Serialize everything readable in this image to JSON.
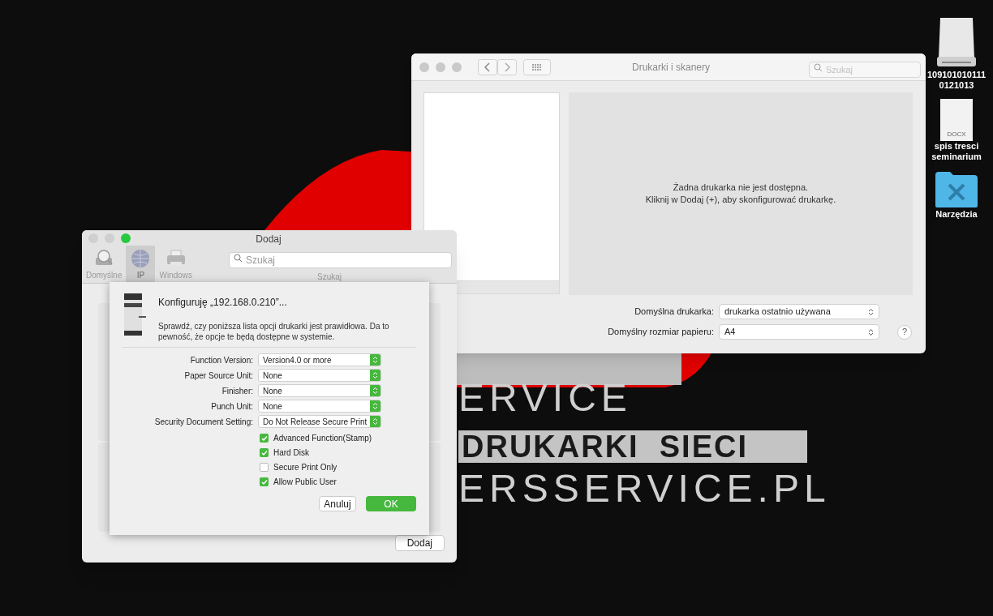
{
  "desktop": {
    "wallpaper_texts": [
      {
        "kind": "light",
        "text": "ERVICE"
      },
      {
        "kind": "band",
        "text": "DRUKARKI  SIECI"
      },
      {
        "kind": "light",
        "text": "ERSSERVICE.PL"
      }
    ],
    "icons": [
      {
        "kind": "drive",
        "lines": [
          "109101010111",
          "0121013"
        ]
      },
      {
        "kind": "document",
        "badge": "DOCX",
        "lines": [
          "spis tresci",
          "seminarium"
        ]
      },
      {
        "kind": "folder",
        "lines": [
          "Narzędzia"
        ]
      }
    ]
  },
  "printers_window": {
    "title": "Drukarki i skanery",
    "traffic_lights": [
      {
        "color": "#c9c9c9"
      },
      {
        "color": "#c9c9c9"
      },
      {
        "color": "#c9c9c9"
      }
    ],
    "search": {
      "placeholder": "Szukaj"
    },
    "empty_message": [
      "Żadna drukarka nie jest dostępna.",
      "Kliknij w Dodaj (+), aby skonfigurować drukarkę."
    ],
    "defaults": [
      {
        "label": "Domyślna drukarka:",
        "value": "drukarka ostatnio używana"
      },
      {
        "label": "Domyślny rozmiar papieru:",
        "value": "A4"
      }
    ],
    "help": "?"
  },
  "add_window": {
    "title": "Dodaj",
    "traffic_lights": [
      {
        "color": "#cfcfcf"
      },
      {
        "color": "#cfcfcf"
      },
      {
        "color": "#27c93f"
      }
    ],
    "tabs": [
      {
        "kind": "default",
        "label": "Domyślne",
        "selected": false
      },
      {
        "kind": "ip",
        "label": "IP",
        "selected": true
      },
      {
        "kind": "windows",
        "label": "Windows",
        "selected": false
      }
    ],
    "search": {
      "placeholder": "Szukaj",
      "caption": "Szukaj"
    },
    "button": "Dodaj",
    "sheet": {
      "title": "Konfiguruję „192.168.0.210”...",
      "description": "Sprawdź, czy poniższa lista opcji drukarki jest prawidłowa. Da to pewność, że opcje te będą dostępne w systemie.",
      "options": [
        {
          "label": "Function Version:",
          "value": "Version4.0 or more"
        },
        {
          "label": "Paper Source Unit:",
          "value": "None"
        },
        {
          "label": "Finisher:",
          "value": "None"
        },
        {
          "label": "Punch Unit:",
          "value": "None"
        },
        {
          "label": "Security Document Setting:",
          "value": "Do Not Release Secure Print"
        }
      ],
      "checkboxes": [
        {
          "label": "Advanced Function(Stamp)",
          "checked": true
        },
        {
          "label": "Hard Disk",
          "checked": true
        },
        {
          "label": "Secure Print Only",
          "checked": false
        },
        {
          "label": "Allow Public User",
          "checked": true
        }
      ],
      "buttons": [
        {
          "kind": "cancel",
          "label": "Anuluj"
        },
        {
          "kind": "default",
          "label": "OK"
        }
      ]
    }
  }
}
